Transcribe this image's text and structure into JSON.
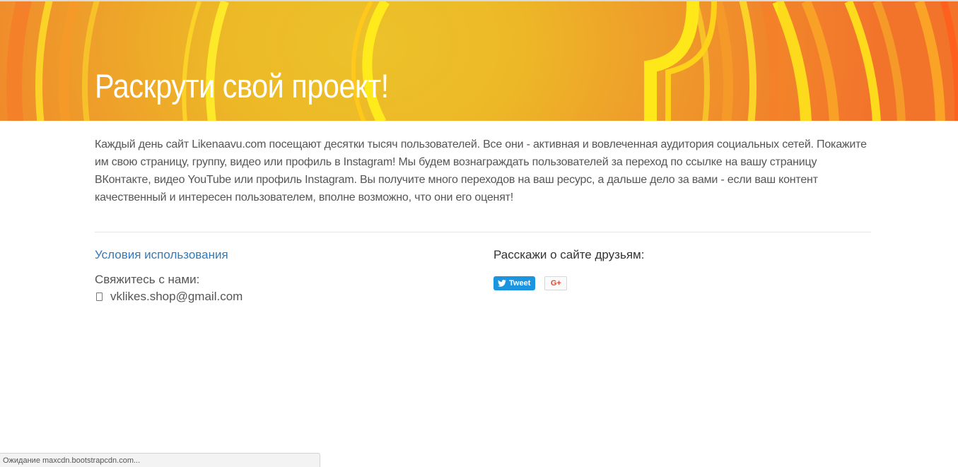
{
  "hero": {
    "title": "Раскрути свой проект!"
  },
  "intro": {
    "text": "Каждый день сайт Likenaavu.com посещают десятки тысяч пользователей. Все они - активная и вовлеченная аудитория социальных сетей. Покажите им свою страницу, группу, видео или профиль в Instagram! Мы будем вознаграждать пользователей за переход по ссылке на вашу страницу ВКонтакте, видео YouTube или профиль Instagram. Вы получите много переходов на ваш ресурс, а дальше дело за вами - если ваш контент качественный и интересен пользователем, вполне возможно, что они его оценят!"
  },
  "footer": {
    "terms_link": "Условия использования",
    "contact_label": "Свяжитесь с нами:",
    "contact_email": "vklikes.shop@gmail.com",
    "share_title": "Расскажи о сайте друзьям:",
    "tweet_label": "Tweet",
    "gplus_label": "G+"
  },
  "statusbar": {
    "text": "Ожидание maxcdn.bootstrapcdn.com..."
  },
  "colors": {
    "link": "#337ab7",
    "tweet": "#1b95e0",
    "gplus": "#dd4b39",
    "hero_yellow": "#ffe81a",
    "hero_orange": "#f1702c"
  }
}
